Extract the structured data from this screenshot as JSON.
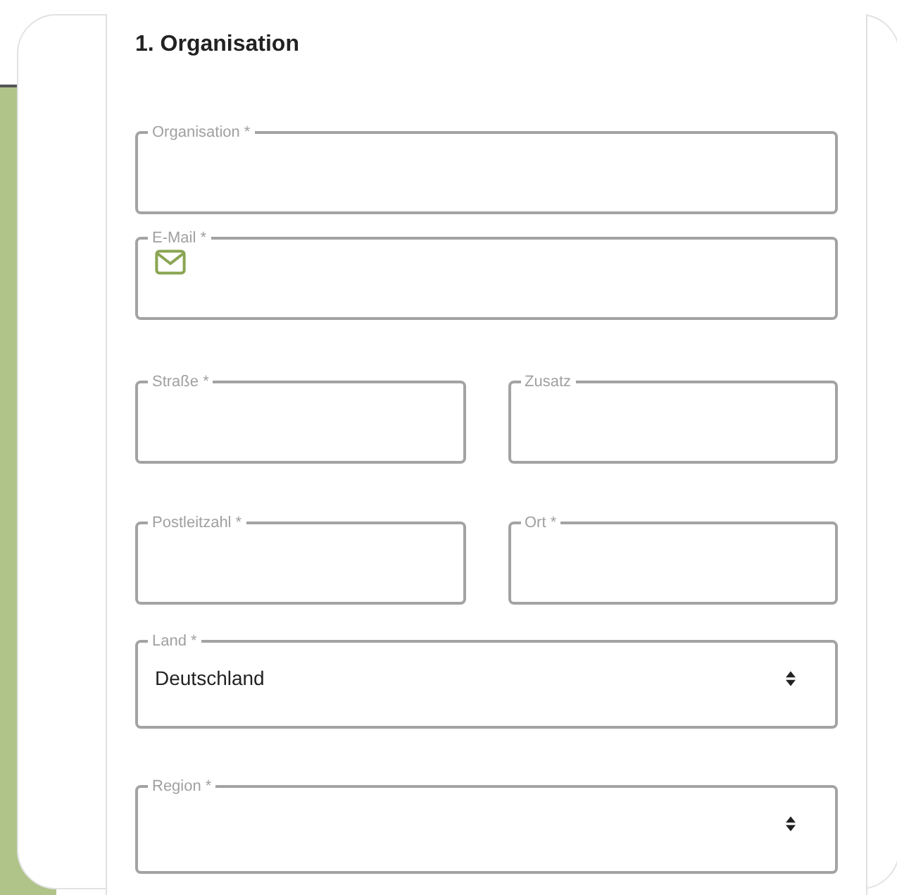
{
  "section_title": "1. Organisation",
  "rows": [
    [
      {
        "kind": "text",
        "label": "Organisation *"
      }
    ],
    [
      {
        "kind": "email",
        "label": "E-Mail *"
      }
    ],
    [
      {
        "kind": "text",
        "label": "Straße *"
      },
      {
        "kind": "text",
        "label": "Zusatz"
      }
    ],
    [
      {
        "kind": "text",
        "label": "Postleitzahl *"
      },
      {
        "kind": "text",
        "label": "Ort *"
      }
    ],
    [
      {
        "kind": "select",
        "label": "Land *",
        "value": "Deutschland"
      }
    ],
    [
      {
        "kind": "select",
        "label": "Region *"
      }
    ]
  ]
}
